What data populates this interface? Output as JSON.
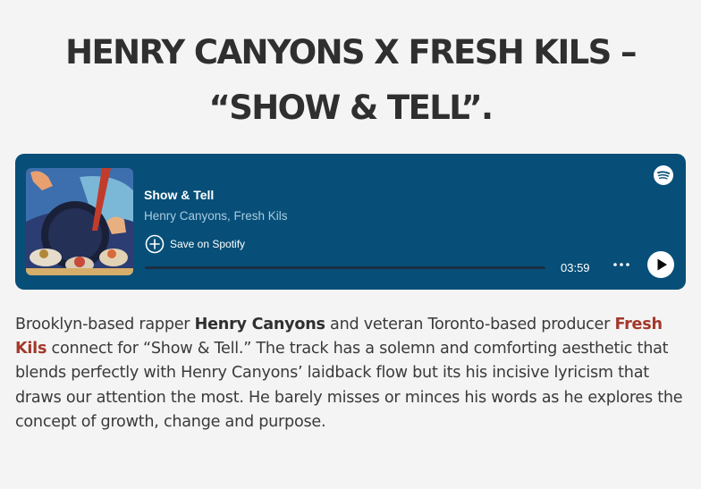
{
  "article": {
    "headline": "HENRY CANYONS X FRESH KILS – “SHOW & TELL”."
  },
  "player": {
    "track_title": "Show & Tell",
    "artists": "Henry Canyons, Fresh Kils",
    "save_label": "Save on Spotify",
    "duration": "03:59",
    "progress": 0,
    "background_color": "#074f78",
    "icons": [
      "spotify-logo-icon",
      "plus-circle-icon",
      "more-dots-icon",
      "play-icon"
    ]
  },
  "body": {
    "intro": "Brooklyn-based rapper ",
    "artist_name": "Henry Canyons",
    "middle": " and veteran Toronto-based producer ",
    "producer_link": "Fresh Kils",
    "rest": " connect for “Show & Tell.” The track has a solemn and comforting aesthetic that blends perfectly with Henry Canyons’ laidback flow but its his incisive lyricism that draws our attention the most. He barely misses or minces his words as he explores the concept of growth, change and purpose.",
    "link_color": "#a3382a"
  }
}
